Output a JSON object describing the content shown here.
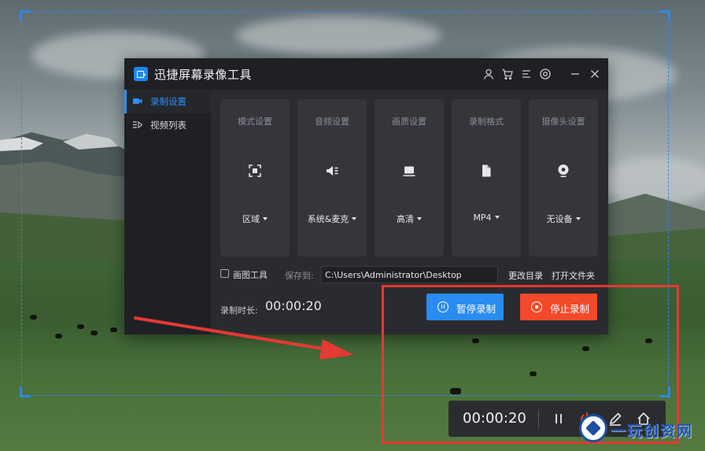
{
  "app": {
    "title": "迅捷屏幕录像工具",
    "accent_color": "#2d8ff3",
    "titlebar_icons": [
      "user-icon",
      "cart-icon",
      "menu-icon",
      "settings-icon",
      "minimize-icon",
      "close-icon"
    ]
  },
  "sidebar": {
    "items": [
      {
        "label": "录制设置",
        "icon": "camera-icon",
        "active": true
      },
      {
        "label": "视频列表",
        "icon": "list-icon",
        "active": false
      }
    ]
  },
  "settings": {
    "cards": [
      {
        "title": "模式设置",
        "value": "区域",
        "icon": "region-icon"
      },
      {
        "title": "音频设置",
        "value": "系统&麦克",
        "icon": "speaker-icon"
      },
      {
        "title": "画质设置",
        "value": "高清",
        "icon": "laptop-icon"
      },
      {
        "title": "录制格式",
        "value": "MP4",
        "icon": "file-icon"
      },
      {
        "title": "摄像头设置",
        "value": "无设备",
        "icon": "webcam-icon"
      }
    ]
  },
  "save": {
    "drawing_tool_label": "画图工具",
    "drawing_tool_checked": false,
    "save_to_label": "保存到:",
    "path": "C:\\Users\\Administrator\\Desktop",
    "change_dir_label": "更改目录",
    "open_folder_label": "打开文件夹"
  },
  "recording": {
    "duration_label": "录制时长:",
    "duration_value": "00:00:20",
    "pause_label": "暂停录制",
    "stop_label": "停止录制",
    "pause_color": "#2a8cf0",
    "stop_color": "#f2492a"
  },
  "mini_bar": {
    "time": "00:00:20",
    "icons": [
      "pause-icon",
      "stop-icon",
      "pen-icon",
      "home-icon"
    ]
  },
  "watermark": {
    "text": "一玩创资网"
  }
}
